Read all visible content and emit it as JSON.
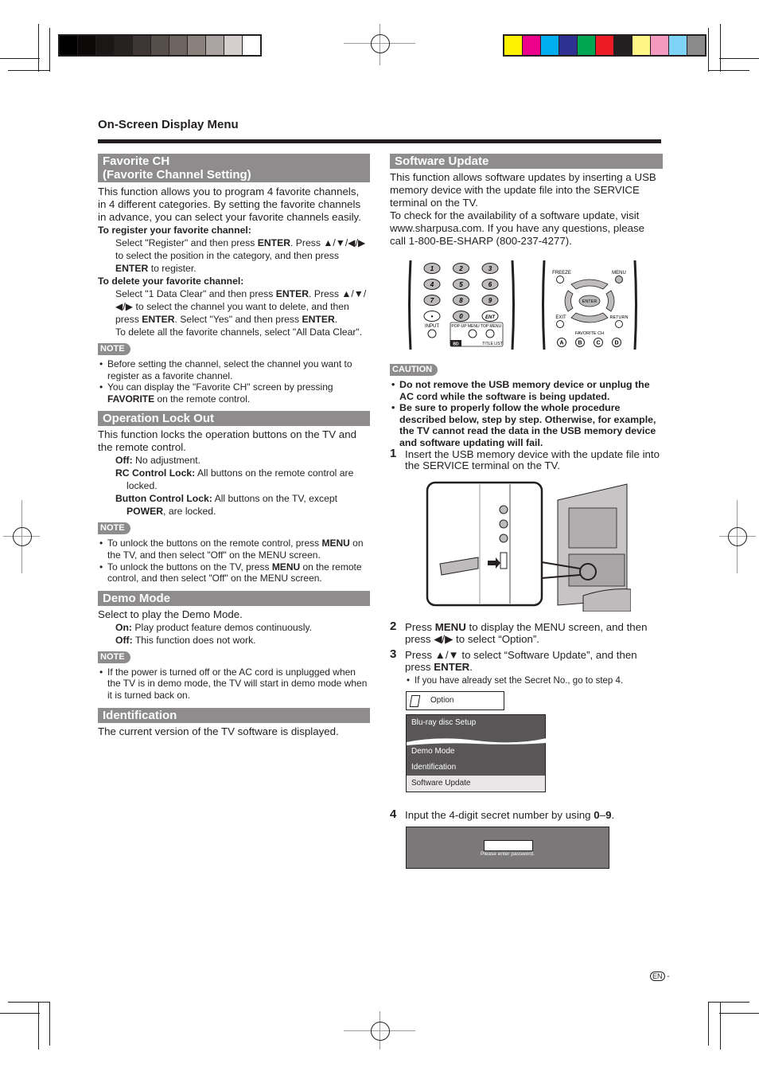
{
  "print_marks": {
    "gray_bar": [
      "#000000",
      "#0c0a09",
      "#1a1716",
      "#262220",
      "#3d3634",
      "#564e4b",
      "#6d6461",
      "#8a817d",
      "#aaa3a1",
      "#d4cecd",
      "#ffffff"
    ],
    "color_bar": [
      "#fff200",
      "#ec008c",
      "#00aeef",
      "#2e3192",
      "#00a651",
      "#ed1c24",
      "#231f20",
      "#fff685",
      "#f49ac1",
      "#7fd3f7",
      "#8a8a8a"
    ]
  },
  "header": {
    "title": "On-Screen Display Menu"
  },
  "left": {
    "favorite": {
      "title_line1": "Favorite CH",
      "title_line2": "(Favorite Channel Setting)",
      "intro": "This function allows you to program 4 favorite channels, in 4 different categories. By setting the favorite channels in advance, you can select your favorite channels easily.",
      "register_head": "To register your favorite channel:",
      "register_a": "Select \"Register\" and then press ",
      "enter": "ENTER",
      "register_b": ". Press ▲/▼/◀/▶ to select the position in the category, and then press ",
      "register_c": " to register.",
      "delete_head": "To delete your favorite channel:",
      "delete_a": "Select \"1 Data Clear\" and then press ",
      "delete_b": ". Press ▲/▼/◀/▶ to select the channel you want to delete, and then press ",
      "delete_c": ". Select \"Yes\" and then press ",
      "delete_d": ".",
      "delete_all": "To delete all the favorite channels, select \"All Data Clear\".",
      "note_label": "NOTE",
      "note1": "Before setting the channel, select the channel you want to register as a favorite channel.",
      "note2_a": "You can display the \"Favorite CH\" screen by pressing ",
      "note2_bold": "FAVORITE",
      "note2_b": " on the remote control."
    },
    "lock": {
      "title": "Operation Lock Out",
      "intro": "This function locks the operation buttons on the TV and the remote control.",
      "off_label": "Off:",
      "off_text": " No adjustment.",
      "rc_label": "RC Control Lock:",
      "rc_text": " All buttons on the remote control are locked.",
      "btn_label": "Button Control Lock:",
      "btn_text_a": " All buttons on the TV, except ",
      "btn_bold": "POWER",
      "btn_text_b": ", are locked.",
      "note_label": "NOTE",
      "note1_a": "To unlock the buttons on the remote control, press ",
      "menu": "MENU",
      "note1_b": " on the TV, and then select \"Off\" on the MENU screen.",
      "note2_a": "To unlock the buttons on the TV, press ",
      "note2_b": " on the remote control, and then select \"Off\" on the MENU screen."
    },
    "demo": {
      "title": "Demo Mode",
      "intro": "Select to play the Demo Mode.",
      "on_label": "On:",
      "on_text": " Play product feature demos continuously.",
      "off_label": "Off:",
      "off_text": " This function does not work.",
      "note_label": "NOTE",
      "note1": "If the power is turned off or the AC cord is unplugged when the TV is in demo mode, the TV will start in demo mode when it is turned back on."
    },
    "ident": {
      "title": "Identification",
      "text": "The current version of the TV software is displayed."
    }
  },
  "right": {
    "title": "Software Update",
    "intro1": "This function allows software updates by inserting a USB memory device with the update file into the SERVICE terminal on the TV.",
    "intro2": "To check for the availability of a software update, visit www.sharpusa.com. If you have any questions, please call 1-800-BE-SHARP (800-237-4277).",
    "remote_left": {
      "keys": [
        "1",
        "2",
        "3",
        "4",
        "5",
        "6",
        "7",
        "8",
        "9",
        "•",
        "0",
        "ENT"
      ],
      "input": "INPUT",
      "popup": "POP-UP MENU",
      "top": "TOP MENU",
      "bd": "BD",
      "title_list": "TITLE LIST"
    },
    "remote_right": {
      "freeze": "FREEZE",
      "menu": "MENU",
      "enter": "ENTER",
      "exit": "EXIT",
      "return": "RETURN",
      "fav": "FAVORITE CH",
      "a": "A",
      "b": "B",
      "c": "C",
      "d": "D"
    },
    "caution_label": "CAUTION",
    "caution1": "Do not remove the USB memory device or unplug the AC cord while the software is being updated.",
    "caution2": "Be sure to properly follow the whole procedure described below, step by step. Otherwise, for example, the TV cannot read the data in the USB memory device and software updating will fail.",
    "step1_num": "1",
    "step1": "Insert the USB memory device with the update file into the SERVICE terminal on the TV.",
    "step2_num": "2",
    "step2_a": "Press ",
    "step2_bold": "MENU",
    "step2_b": " to display the MENU screen, and then press ◀/▶ to select “Option”.",
    "step3_num": "3",
    "step3_a": "Press ▲/▼ to select “Software Update”, and then press ",
    "step3_bold": "ENTER",
    "step3_b": ".",
    "step3_note": "If you have already set the Secret No., go to step 4.",
    "menu_screen": {
      "title": "Option",
      "items": [
        "Blu-ray disc Setup",
        "Demo Mode",
        "Identification",
        "Software Update"
      ],
      "selected": "Software Update"
    },
    "step4_num": "4",
    "step4_a": "Input the 4-digit secret number by using ",
    "step4_bold": "0",
    "step4_dash": "–",
    "step4_bold2": "9",
    "step4_b": ".",
    "password_prompt": "Please enter password."
  },
  "footer": {
    "lang": "EN",
    "dash": "-"
  }
}
